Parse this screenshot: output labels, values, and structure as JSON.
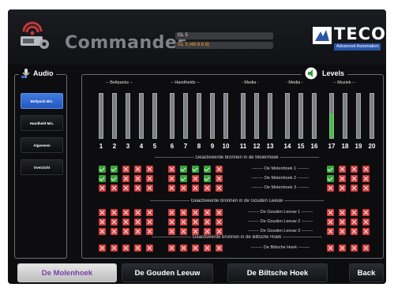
{
  "header": {
    "title": "Commander",
    "gl_line1": "GL 5",
    "gl_line2": "GL 5 (46.8.6.8)",
    "brand": "TECO",
    "brand_sub": "Advanced Automation"
  },
  "audio": {
    "title": "Audio",
    "buttons": [
      "Beltpack Mic.",
      "Handheld Mic.",
      "Algemeen",
      "Overzicht"
    ],
    "active_index": 0
  },
  "levels": {
    "title": "Levels",
    "groups": [
      "-- Beltpacks --",
      "-- Handhelds --",
      "- Media -",
      "- Media -",
      "-- Muziek --"
    ],
    "channels": [
      "1",
      "2",
      "3",
      "4",
      "5",
      "6",
      "7",
      "8",
      "9",
      "10",
      "11",
      "12",
      "13",
      "14",
      "15",
      "16",
      "17",
      "18",
      "19",
      "20"
    ],
    "channel_levels": [
      0,
      0,
      0,
      0,
      0,
      0,
      0,
      0,
      0,
      0,
      0,
      0,
      0,
      0,
      0,
      0,
      0.55,
      0,
      0,
      0
    ]
  },
  "sections": [
    {
      "title": "Geactiveerde bronnen in de Molenhoek",
      "rows": [
        {
          "label": "De Molenhoek 1",
          "states": [
            "ok",
            "ok",
            "x",
            "x",
            "x",
            "x",
            "ok",
            "ok",
            "ok",
            "x",
            "ok",
            "x",
            "x",
            "x"
          ]
        },
        {
          "label": "De Molenhoek 2",
          "states": [
            "ok",
            "ok",
            "x",
            "x",
            "x",
            "x",
            "ok",
            "x",
            "ok",
            "x",
            "ok",
            "x",
            "x",
            "x"
          ]
        },
        {
          "label": "De Molenhoek 3",
          "states": [
            "x",
            "x",
            "x",
            "x",
            "x",
            "x",
            "x",
            "x",
            "x",
            "x",
            "x",
            "x",
            "x",
            "x"
          ]
        }
      ]
    },
    {
      "title": "Geactiveerde bronnen in de Gouden Leeuw",
      "rows": [
        {
          "label": "De Gouden Leeuw 1",
          "states": [
            "x",
            "x",
            "x",
            "x",
            "x",
            "x",
            "x",
            "x",
            "x",
            "x",
            "x",
            "x",
            "x",
            "x"
          ]
        },
        {
          "label": "De Gouden Leeuw 2",
          "states": [
            "x",
            "x",
            "x",
            "x",
            "x",
            "x",
            "x",
            "x",
            "x",
            "x",
            "x",
            "x",
            "x",
            "x"
          ]
        },
        {
          "label": "De Gouden Leeuw 3",
          "states": [
            "x",
            "x",
            "x",
            "x",
            "x",
            "x",
            "x",
            "x",
            "x",
            "x",
            "x",
            "x",
            "x",
            "x"
          ]
        }
      ]
    },
    {
      "title": "Geactiveerde bronnen in de Biltsche Hoek",
      "rows": [
        {
          "label": "De Biltsche Hoek",
          "states": [
            "x",
            "x",
            "x",
            "x",
            "x",
            "x",
            "x",
            "x",
            "x",
            "x",
            "x",
            "x",
            "x",
            "x"
          ]
        }
      ]
    }
  ],
  "bottom": {
    "buttons": [
      "De Molenhoek",
      "De Gouden Leeuw",
      "De Biltsche Hoek",
      "Back"
    ],
    "active_index": 0
  },
  "colors": {
    "active_blue": "#2f6bd6",
    "check_green": "#3aa43a",
    "cross_red": "#d03c3c",
    "level_green": "#3ec43e"
  }
}
